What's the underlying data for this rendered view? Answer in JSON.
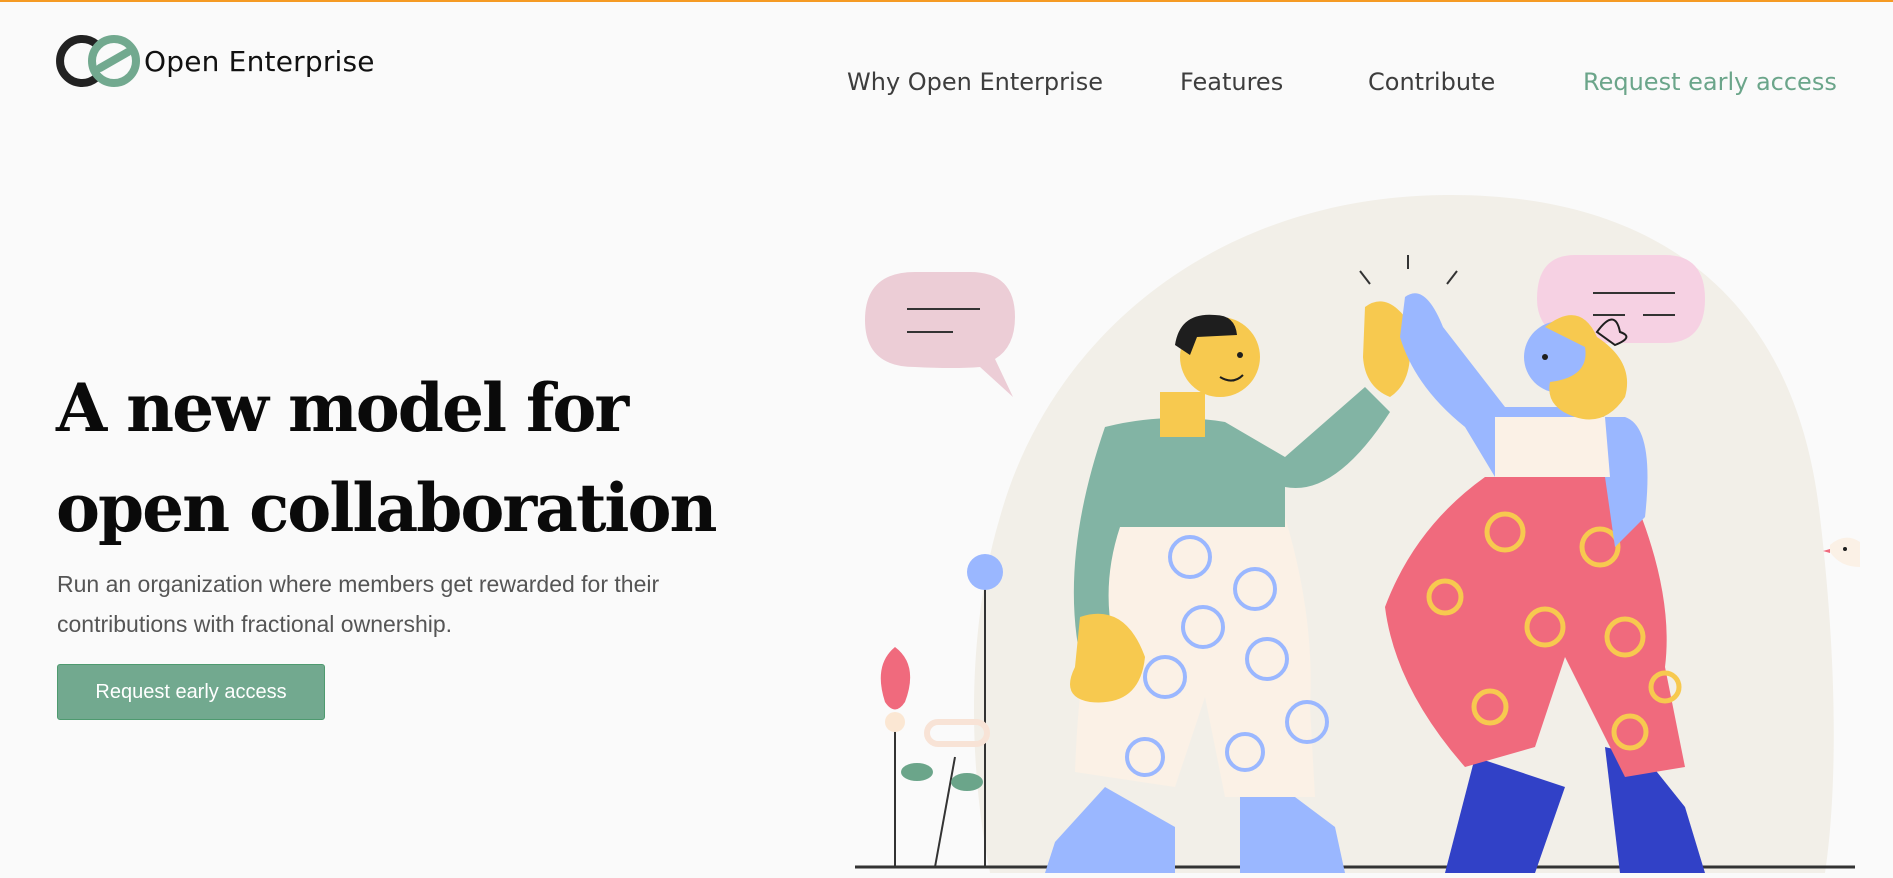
{
  "brand": {
    "name": "Open Enterprise",
    "logo_icon": "oe-logo-icon",
    "accent_color": "#72a98f",
    "top_bar_color": "#f59a23"
  },
  "nav": {
    "items": [
      {
        "label": "Why Open Enterprise"
      },
      {
        "label": "Features"
      },
      {
        "label": "Contribute"
      },
      {
        "label": "Request early access",
        "accent": true
      }
    ]
  },
  "hero": {
    "title_line1": "A new model for",
    "title_line2": "open collaboration",
    "subtitle": "Run an organization where members get rewarded for their contributions with fractional ownership.",
    "cta_label": "Request early access",
    "illustration": "high-five-illustration"
  }
}
